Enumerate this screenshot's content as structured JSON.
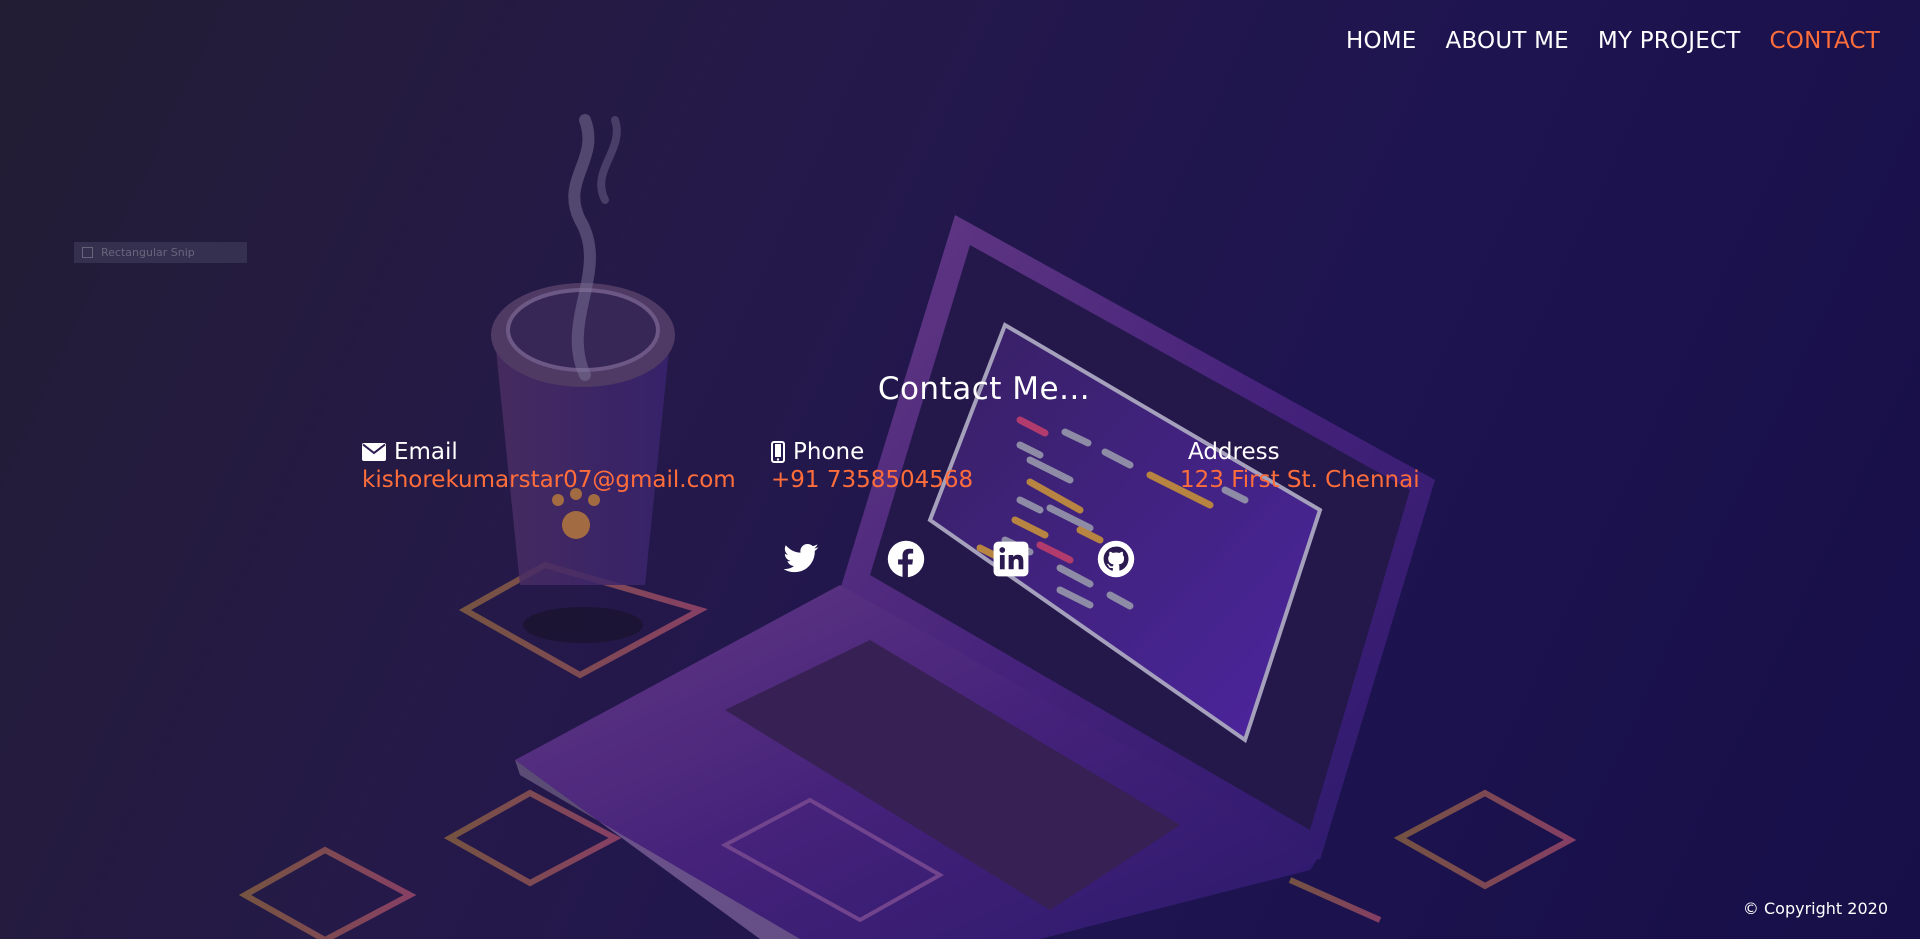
{
  "nav": {
    "items": [
      {
        "label": "HOME",
        "active": false
      },
      {
        "label": "ABOUT ME",
        "active": false
      },
      {
        "label": "MY PROJECT",
        "active": false
      },
      {
        "label": "CONTACT",
        "active": true
      }
    ]
  },
  "snip": {
    "label": "Rectangular Snip"
  },
  "contact": {
    "title": "Contact Me...",
    "email": {
      "label": "Email",
      "value": "kishorekumarstar07@gmail.com",
      "icon": "envelope-icon"
    },
    "phone": {
      "label": "Phone",
      "value": "+91 7358504568",
      "icon": "mobile-phone-icon"
    },
    "address": {
      "label": "Address",
      "value": "123 First St. Chennai"
    }
  },
  "social": {
    "items": [
      {
        "name": "twitter",
        "icon": "twitter-icon"
      },
      {
        "name": "facebook",
        "icon": "facebook-icon"
      },
      {
        "name": "linkedin",
        "icon": "linkedin-icon"
      },
      {
        "name": "github",
        "icon": "github-icon"
      }
    ]
  },
  "footer": {
    "copyright": "© Copyright 2020"
  },
  "colors": {
    "accent": "#ff6d3b",
    "text": "#ffffff",
    "background": "#1e1450"
  }
}
